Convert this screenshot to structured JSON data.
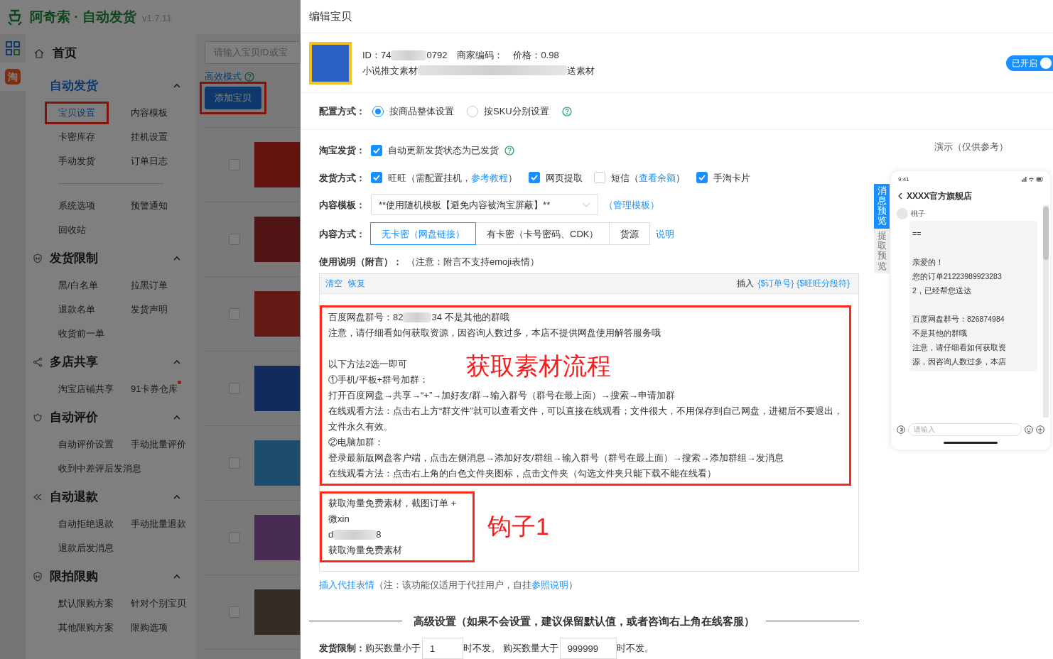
{
  "app": {
    "logo": "阿奇索 · 自动发货",
    "version": "v1.7.11",
    "rail_badge": "淘"
  },
  "nav": {
    "home": "首页",
    "groups": [
      {
        "title": "自动发货",
        "expanded": true,
        "active": true,
        "sections": [
          [
            {
              "label": "宝贝设置",
              "selected": true,
              "highlighted": true,
              "dot": false
            },
            {
              "label": "内容模板",
              "selected": false,
              "highlighted": false,
              "dot": false
            },
            {
              "label": "卡密库存",
              "selected": false,
              "highlighted": false,
              "dot": false
            },
            {
              "label": "挂机设置",
              "selected": false,
              "highlighted": false,
              "dot": false
            },
            {
              "label": "手动发货",
              "selected": false,
              "highlighted": false,
              "dot": false
            },
            {
              "label": "订单日志",
              "selected": false,
              "highlighted": false,
              "dot": false
            }
          ],
          [
            {
              "label": "系统选项",
              "selected": false,
              "highlighted": false,
              "dot": false
            },
            {
              "label": "预警通知",
              "selected": false,
              "highlighted": false,
              "dot": false
            },
            {
              "label": "回收站",
              "selected": false,
              "highlighted": false,
              "dot": false
            }
          ]
        ]
      },
      {
        "title": "发货限制",
        "expanded": true,
        "active": false,
        "sections": [
          [
            {
              "label": "黑/白名单",
              "selected": false,
              "highlighted": false,
              "dot": false
            },
            {
              "label": "拉黑订单",
              "selected": false,
              "highlighted": false,
              "dot": false
            },
            {
              "label": "退款名单",
              "selected": false,
              "highlighted": false,
              "dot": false
            },
            {
              "label": "发货声明",
              "selected": false,
              "highlighted": false,
              "dot": false
            },
            {
              "label": "收货前一单",
              "selected": false,
              "highlighted": false,
              "dot": false
            }
          ]
        ]
      },
      {
        "title": "多店共享",
        "expanded": true,
        "active": false,
        "sections": [
          [
            {
              "label": "淘宝店铺共享",
              "selected": false,
              "highlighted": false,
              "dot": false
            },
            {
              "label": "91卡券仓库",
              "selected": false,
              "highlighted": false,
              "dot": true
            }
          ]
        ]
      },
      {
        "title": "自动评价",
        "expanded": true,
        "active": false,
        "sections": [
          [
            {
              "label": "自动评价设置",
              "selected": false,
              "highlighted": false,
              "dot": false
            },
            {
              "label": "手动批量评价",
              "selected": false,
              "highlighted": false,
              "dot": false
            },
            {
              "label": "收到中差评后发消息",
              "selected": false,
              "highlighted": false,
              "dot": false
            }
          ]
        ]
      },
      {
        "title": "自动退款",
        "expanded": true,
        "active": false,
        "sections": [
          [
            {
              "label": "自动拒绝退款",
              "selected": false,
              "highlighted": false,
              "dot": false
            },
            {
              "label": "手动批量退款",
              "selected": false,
              "highlighted": false,
              "dot": false
            },
            {
              "label": "退款后发消息",
              "selected": false,
              "highlighted": false,
              "dot": false
            }
          ]
        ]
      },
      {
        "title": "限拍限购",
        "expanded": true,
        "active": false,
        "sections": [
          [
            {
              "label": "默认限购方案",
              "selected": false,
              "highlighted": false,
              "dot": false
            },
            {
              "label": "针对个别宝贝",
              "selected": false,
              "highlighted": false,
              "dot": false
            },
            {
              "label": "其他限购方案",
              "selected": false,
              "highlighted": false,
              "dot": false
            },
            {
              "label": "限购选项",
              "selected": false,
              "highlighted": false,
              "dot": false
            }
          ]
        ]
      }
    ]
  },
  "list": {
    "search_placeholder": "请输入宝贝ID或宝",
    "mode_link": "高效模式",
    "add_button": {
      "label": "添加宝贝",
      "highlighted": true
    },
    "products": [
      {
        "checked": false
      },
      {
        "checked": false
      },
      {
        "checked": false
      },
      {
        "checked": false
      },
      {
        "checked": false
      },
      {
        "checked": false
      },
      {
        "checked": false
      }
    ]
  },
  "dialog": {
    "title": "编辑宝贝",
    "product": {
      "id_label": "ID：",
      "id": [
        "74",
        "0792"
      ],
      "code_label": "商家编码：",
      "price": "价格：0.98",
      "title": [
        "小说推文素材",
        "送素材"
      ],
      "toggle": {
        "label": "已开启",
        "on": true
      }
    },
    "config": {
      "label": "配置方式：",
      "options": [
        {
          "label": "按商品整体设置",
          "selected": true
        },
        {
          "label": "按SKU分别设置",
          "selected": false
        }
      ]
    },
    "taobao": {
      "label": "淘宝发货：",
      "option": {
        "label": "自动更新发货状态为已发货",
        "checked": true
      }
    },
    "delivery": {
      "label": "发货方式：",
      "options": [
        {
          "label": "旺旺（需配置挂机，",
          "link": "参考教程",
          "suffix": "）",
          "checked": true
        },
        {
          "label": "网页提取",
          "checked": true
        },
        {
          "label": "短信（",
          "link": "查看余额",
          "suffix": "）",
          "checked": false
        },
        {
          "label": "手淘卡片",
          "checked": true
        }
      ]
    },
    "template": {
      "label": "内容模板：",
      "value": "**使用随机模板【避免内容被淘宝屏蔽】**",
      "link": "（管理模板）"
    },
    "content_mode": {
      "label": "内容方式：",
      "segments": [
        {
          "label": "无卡密（网盘链接）",
          "selected": true
        },
        {
          "label": "有卡密（卡号密码、CDK）",
          "selected": false
        },
        {
          "label": "货源",
          "selected": false
        }
      ],
      "link": "说明"
    },
    "usage": {
      "label": "使用说明（附言）：",
      "note": "（注意：附言不支持emoji表情）"
    },
    "editor": {
      "actions": [
        "清空",
        "恢复"
      ],
      "insert_label": "插入",
      "tokens": [
        "{$订单号}",
        "{$旺旺分段符}"
      ],
      "blocks": [
        {
          "annotation": "获取素材流程",
          "lines": [
            [
              "百度网盘群号：82",
              "34   不是其他的群哦"
            ],
            [
              "注意，请仔细看如何获取资源，因咨询人数过多，本店不提供网盘使用解答服务哦"
            ],
            [
              "以下方法2选一即可"
            ],
            [
              "①手机/平板+群号加群："
            ],
            [
              "打开百度网盘→共享→“+”→加好友/群→输入群号（群号在最上面）→搜索→申请加群"
            ],
            [
              "在线观看方法：点击右上方“群文件”就可以查看文件，可以直接在线观看；文件很大，不用保存到自己网盘，进裙后不要退出，文件永久有效。"
            ],
            [
              "②电脑加群："
            ],
            [
              "登录最新版网盘客户端，点击左侧消息→添加好友/群组→输入群号（群号在最上面）→搜索→添加群组→发消息"
            ],
            [
              "在线观看方法：点击右上角的白色文件夹图标，点击文件夹（勾选文件夹只能下载不能在线看）"
            ]
          ]
        },
        {
          "annotation": "钩子1",
          "lines": [
            [
              "获取海量免费素材，截图订单 +"
            ],
            [
              "微xin"
            ],
            [
              "d",
              "8"
            ],
            [
              "获取海量免费素材"
            ]
          ]
        }
      ]
    },
    "emoji_note": {
      "link": "插入代挂表情",
      "text": "（注：该功能仅适用于代挂用户，自挂",
      "link2": "参照说明",
      "end": "）"
    },
    "advanced": "高级设置（如果不会设置，建议保留默认值，或者咨询右上角在线客服）",
    "limit": {
      "label": "发货限制：",
      "before_min": "购买数量小于",
      "min": "1",
      "mid": "时不发。 购买数量大于",
      "max": "999999",
      "after": "时不发。"
    },
    "preview": {
      "title": "演示（仅供参考）",
      "tabs": [
        {
          "label": "消息预览",
          "selected": true
        },
        {
          "label": "提取预览",
          "selected": false
        }
      ],
      "time": "9:41",
      "shop": "XXXX官方旗舰店",
      "sender": "桃子",
      "paragraphs": [
        [
          "=="
        ],
        [
          "亲爱的！",
          "您的订单21223989923283",
          "2，已经帮您送达"
        ],
        [
          "百度网盘群号：826874984",
          "不是其他的群哦",
          "注意，请仔细看如何获取资",
          "源，因咨询人数过多，本店"
        ]
      ],
      "input_placeholder": "请输入"
    }
  }
}
